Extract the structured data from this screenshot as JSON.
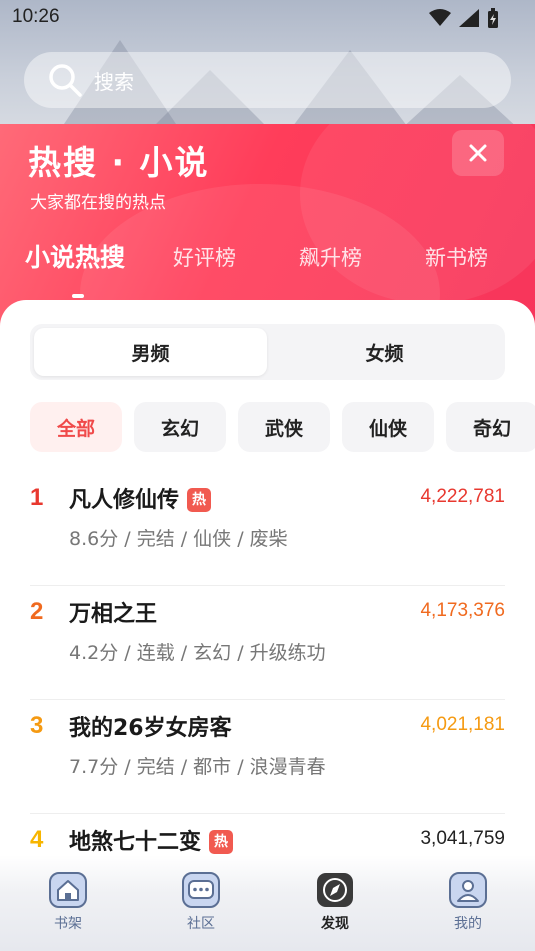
{
  "status_bar": {
    "time": "10:26"
  },
  "search": {
    "placeholder": "搜索"
  },
  "banner": {
    "title": "热搜 · 小说",
    "subtitle": "大家都在搜的热点"
  },
  "tabs": [
    {
      "label": "小说热搜",
      "active": true
    },
    {
      "label": "好评榜"
    },
    {
      "label": "飙升榜"
    },
    {
      "label": "新书榜"
    }
  ],
  "gender_toggle": {
    "male": "男频",
    "female": "女频",
    "selected": "男频"
  },
  "categories": [
    "全部",
    "玄幻",
    "武侠",
    "仙侠",
    "奇幻"
  ],
  "selected_category": "全部",
  "ranking": [
    {
      "rank": "1",
      "title": "凡人修仙传",
      "hot": "热",
      "meta": "8.6分 / 完结 / 仙侠 / 废柴",
      "count": "4,222,781",
      "color": "#e8382f"
    },
    {
      "rank": "2",
      "title": "万相之王",
      "hot": "",
      "meta": "4.2分 / 连载 / 玄幻 / 升级练功",
      "count": "4,173,376",
      "color": "#f06a1f"
    },
    {
      "rank": "3",
      "title": "我的26岁女房客",
      "hot": "",
      "meta": "7.7分 / 完结 / 都市 / 浪漫青春",
      "count": "4,021,181",
      "color": "#f59a12"
    },
    {
      "rank": "4",
      "title": "地煞七十二变",
      "hot": "热",
      "meta": "",
      "count": "3,041,759",
      "color": "#f7b500"
    }
  ],
  "bottom_nav": [
    {
      "label": "书架",
      "icon": "house-icon"
    },
    {
      "label": "社区",
      "icon": "chat-icon"
    },
    {
      "label": "发现",
      "icon": "compass-icon",
      "active": true
    },
    {
      "label": "我的",
      "icon": "person-icon"
    }
  ]
}
